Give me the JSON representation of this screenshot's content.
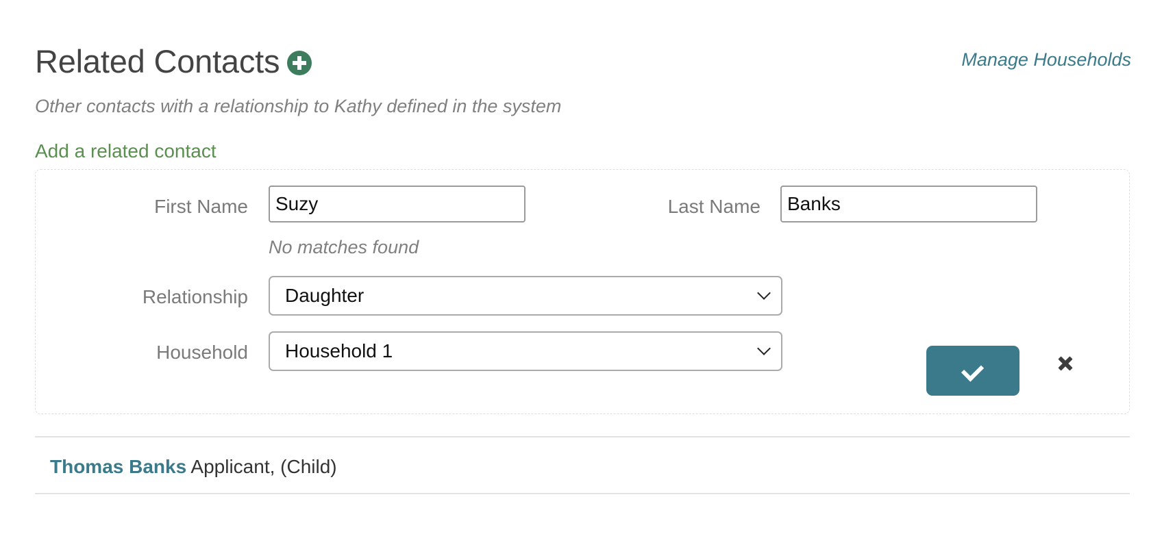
{
  "header": {
    "title": "Related Contacts",
    "manage_households": "Manage Households",
    "subtitle": "Other contacts with a relationship to Kathy defined in the system"
  },
  "form": {
    "heading": "Add a related contact",
    "first_name_label": "First Name",
    "first_name_value": "Suzy",
    "last_name_label": "Last Name",
    "last_name_value": "Banks",
    "match_hint": "No matches found",
    "relationship_label": "Relationship",
    "relationship_value": "Daughter",
    "household_label": "Household",
    "household_value": "Household 1",
    "submit_icon": "check-icon",
    "cancel_icon": "close-icon"
  },
  "contacts": [
    {
      "name": "Thomas Banks",
      "detail": "Applicant, (Child)"
    }
  ],
  "colors": {
    "accent": "#3a7a8a",
    "add_green": "#3d7c5d",
    "link_green": "#5a8f4f"
  }
}
